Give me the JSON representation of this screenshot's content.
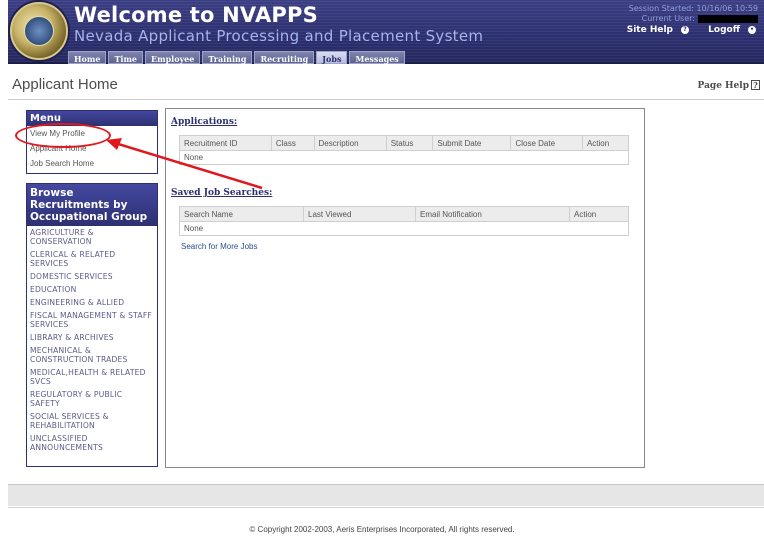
{
  "header": {
    "title": "Welcome to NVAPPS",
    "subtitle": "Nevada Applicant Processing and Placement System",
    "session_started_label": "Session Started:",
    "session_started_value": "10/16/06 10:59",
    "current_user_label": "Current User:",
    "site_help": "Site Help",
    "logoff": "Logoff"
  },
  "nav": {
    "tabs": [
      {
        "label": "Home"
      },
      {
        "label": "Time"
      },
      {
        "label": "Employee"
      },
      {
        "label": "Training"
      },
      {
        "label": "Recruiting"
      },
      {
        "label": "Jobs",
        "active": true
      },
      {
        "label": "Messages"
      }
    ]
  },
  "page": {
    "title": "Applicant Home",
    "help": "Page Help"
  },
  "menu": {
    "header": "Menu",
    "items": [
      {
        "label": "View My Profile"
      },
      {
        "label": "Applicant Home"
      },
      {
        "label": "Job Search Home"
      }
    ]
  },
  "browse": {
    "header": "Browse Recruitments by Occupational Group",
    "items": [
      {
        "label": "AGRICULTURE & CONSERVATION"
      },
      {
        "label": "CLERICAL & RELATED SERVICES"
      },
      {
        "label": "DOMESTIC SERVICES"
      },
      {
        "label": "EDUCATION"
      },
      {
        "label": "ENGINEERING & ALLIED"
      },
      {
        "label": "FISCAL MANAGEMENT & STAFF SERVICES"
      },
      {
        "label": "LIBRARY & ARCHIVES"
      },
      {
        "label": "MECHANICAL & CONSTRUCTION TRADES"
      },
      {
        "label": "MEDICAL,HEALTH & RELATED SVCS"
      },
      {
        "label": "REGULATORY & PUBLIC SAFETY"
      },
      {
        "label": "SOCIAL SERVICES & REHABILITATION"
      },
      {
        "label": "UNCLASSIFIED ANNOUNCEMENTS"
      }
    ]
  },
  "applications": {
    "title": "Applications:",
    "columns": [
      "Recruitment ID",
      "Class",
      "Description",
      "Status",
      "Submit Date",
      "Close Date",
      "Action"
    ],
    "empty": "None"
  },
  "saved_searches": {
    "title": "Saved Job Searches:",
    "columns": [
      "Search Name",
      "Last Viewed",
      "Email Notification",
      "Action"
    ],
    "empty": "None",
    "more_link": "Search for More Jobs"
  },
  "footer": {
    "copyright": "© Copyright 2002-2003, Aeris Enterprises Incorporated, All rights reserved."
  },
  "colors": {
    "header": "#2d3070",
    "annotation": "#e0181e"
  }
}
